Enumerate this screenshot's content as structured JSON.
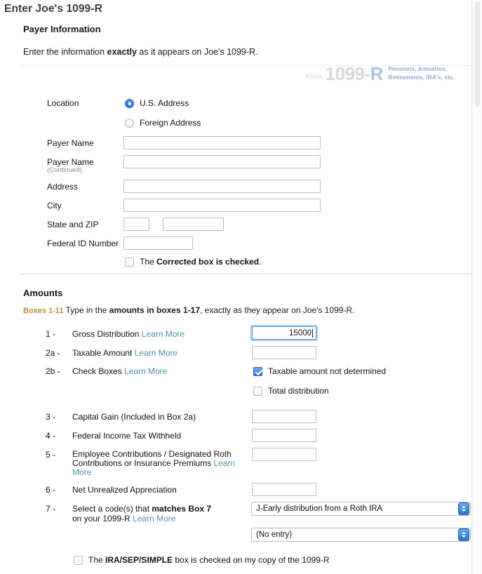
{
  "page": {
    "title": "Enter Joe's 1099-R"
  },
  "payer_section": {
    "heading": "Payer Information",
    "intro_prefix": "Enter the information ",
    "intro_bold": "exactly",
    "intro_suffix": " as it appears on Joe's 1099-R.",
    "form_banner": {
      "form_word": "Form",
      "number": "1099-",
      "letter": "R",
      "desc_line1": "Pensions, Annuities,",
      "desc_line2": "Retirements, IRA's, etc."
    },
    "location": {
      "label": "Location",
      "options": [
        {
          "label": "U.S. Address",
          "checked": true
        },
        {
          "label": "Foreign Address",
          "checked": false
        }
      ]
    },
    "fields": [
      {
        "label": "Payer Name",
        "sub": "",
        "value": ""
      },
      {
        "label": "Payer Name",
        "sub": "(Continued)",
        "value": ""
      },
      {
        "label": "Address",
        "sub": "",
        "value": ""
      },
      {
        "label": "City",
        "sub": "",
        "value": ""
      }
    ],
    "state_zip_label": "State and ZIP",
    "state_value": "",
    "zip_value": "",
    "federal_id_label": "Federal ID Number",
    "federal_id_value": "",
    "corrected_checkbox": {
      "checked": false,
      "prefix": "The ",
      "bold": "Corrected box is checked",
      "suffix": "."
    }
  },
  "amounts_section": {
    "heading": "Amounts",
    "boxes_tag": "Boxes 1-11",
    "intro_a": " Type in the ",
    "intro_bold": "amounts in boxes 1-17",
    "intro_b": ", exactly as they appear on Joe's 1099-R.",
    "learn_more": "Learn More",
    "rows": [
      {
        "num": "1 -",
        "label": "Gross Distribution",
        "has_link": true,
        "value": "15000",
        "focused": true
      },
      {
        "num": "2a -",
        "label": "Taxable Amount",
        "has_link": true,
        "value": "",
        "focused": false
      },
      {
        "num": "3 -",
        "label": "Capital Gain (Included in Box 2a)",
        "has_link": false,
        "value": "",
        "focused": false
      },
      {
        "num": "4 -",
        "label": "Federal Income Tax Withheld",
        "has_link": false,
        "value": "",
        "focused": false
      },
      {
        "num": "6 -",
        "label": "Net Unrealized Appreciation",
        "has_link": false,
        "value": "",
        "focused": false
      }
    ],
    "check_boxes_row": {
      "num": "2b -",
      "label": "Check Boxes",
      "link": "Learn More",
      "options": [
        {
          "label": "Taxable amount not determined",
          "checked": true
        },
        {
          "label": "Total distribution",
          "checked": false
        }
      ]
    },
    "row5": {
      "num": "5 -",
      "line1": "Employee Contributions / Designated Roth",
      "line2": "Contributions or Insurance Premiums ",
      "link1": "Learn",
      "link2": "More",
      "value": ""
    },
    "row7": {
      "num": "7 -",
      "line1_a": "Select a code(s) that ",
      "line1_bold": "matches Box 7",
      "line2_a": "on your 1099-R ",
      "link": "Learn More",
      "select1_value": "J-Early distribution from a Roth IRA",
      "select2_value": "(No entry)"
    },
    "ira_checkbox": {
      "checked": false,
      "prefix": "The ",
      "bold": "IRA/SEP/SIMPLE",
      "suffix": " box is checked on my copy of the 1099-R"
    }
  },
  "colors": {
    "accent_blue": "#2f7ad4",
    "link_teal": "#4f93ae",
    "boxes_orange": "#c08b38",
    "banner_blue": "#8fafd0"
  }
}
